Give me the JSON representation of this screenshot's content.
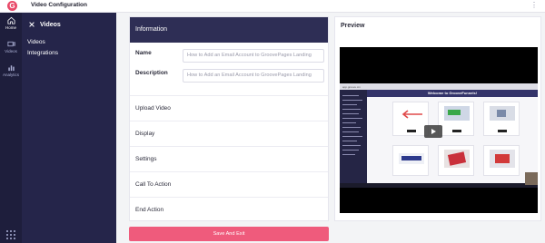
{
  "app": {
    "title": "Video Configuration",
    "logo_letter": "G",
    "menu_icon": "⋮"
  },
  "rail": {
    "items": [
      {
        "label": "Home",
        "icon": "home-icon"
      },
      {
        "label": "Videos",
        "icon": "video-icon"
      },
      {
        "label": "Analytics",
        "icon": "analytics-icon"
      }
    ]
  },
  "sidebar": {
    "heading": "Videos",
    "links": [
      "Videos",
      "Integrations"
    ]
  },
  "form": {
    "header": "Information",
    "name_label": "Name",
    "name_value": "How to Add an Email Account to GroovePages Landing",
    "description_label": "Description",
    "description_value": "How to Add an Email Account to GroovePages Landing",
    "sections": [
      "Upload Video",
      "Display",
      "Settings",
      "Call To Action",
      "End Action"
    ],
    "save_button": "Save And Exit"
  },
  "preview": {
    "title": "Preview",
    "video": {
      "banner": "Welcome to GrooveFunnels!",
      "url": "app.groove.cm"
    }
  },
  "colors": {
    "sidebar": "#25254a",
    "rail": "#1e1e3c",
    "panel_header": "#2e2e55",
    "accent": "#ef5b7c"
  }
}
